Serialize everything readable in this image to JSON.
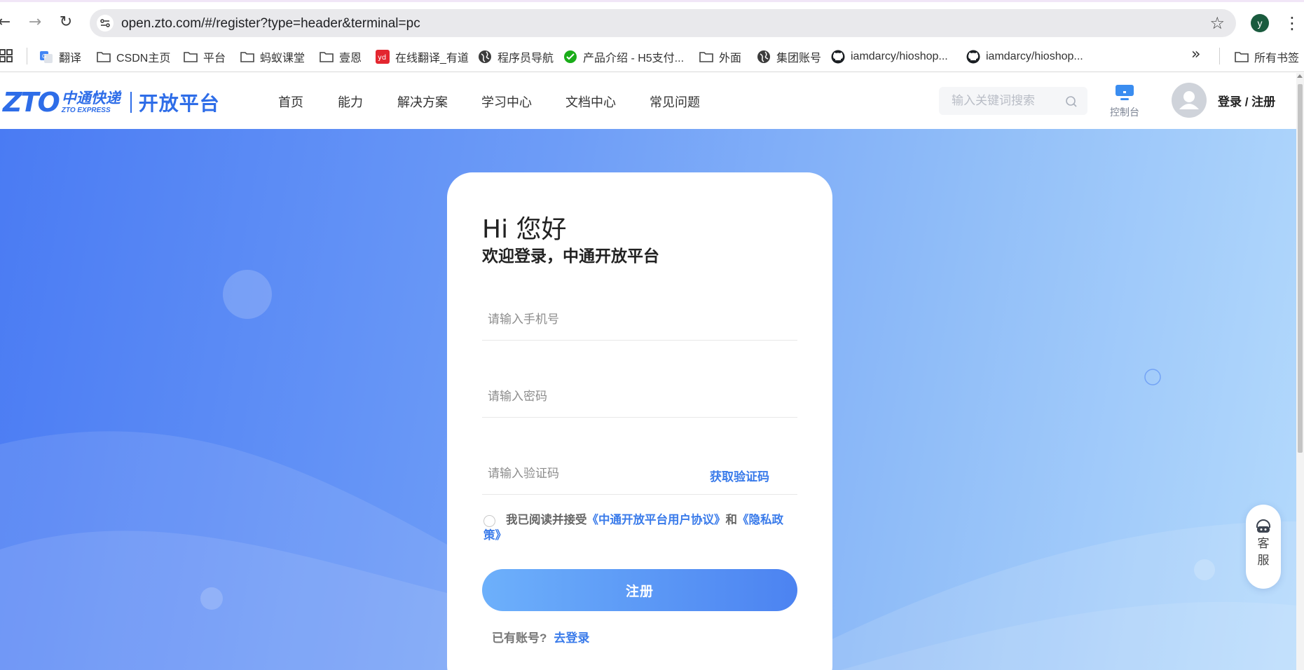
{
  "browser": {
    "url": "open.zto.com/#/register?type=header&terminal=pc",
    "profile_initial": "y",
    "bookmarks": [
      {
        "label": "翻译",
        "icon": "google-translate-icon"
      },
      {
        "label": "CSDN主页",
        "icon": "folder-icon"
      },
      {
        "label": "平台",
        "icon": "folder-icon"
      },
      {
        "label": "蚂蚁课堂",
        "icon": "folder-icon"
      },
      {
        "label": "壹恩",
        "icon": "folder-icon"
      },
      {
        "label": "在线翻译_有道",
        "icon": "youdao-icon"
      },
      {
        "label": "程序员导航",
        "icon": "globe-icon"
      },
      {
        "label": "产品介绍 - H5支付...",
        "icon": "wechat-icon"
      },
      {
        "label": "外面",
        "icon": "folder-icon"
      },
      {
        "label": "集团账号",
        "icon": "globe-icon"
      },
      {
        "label": "iamdarcy/hioshop...",
        "icon": "github-icon"
      },
      {
        "label": "iamdarcy/hioshop...",
        "icon": "github-icon"
      }
    ],
    "all_bookmarks_label": "所有书签"
  },
  "site": {
    "logo_text": "ZTO",
    "logo_cn": "中通快递",
    "logo_en": "ZTO EXPRESS",
    "platform_name": "开放平台",
    "nav": [
      "首页",
      "能力",
      "解决方案",
      "学习中心",
      "文档中心",
      "常见问题"
    ],
    "search_placeholder": "输入关键词搜索",
    "console_label": "控制台",
    "login_label": "登录 / 注册"
  },
  "form": {
    "greeting": "Hi 您好",
    "welcome": "欢迎登录，中通开放平台",
    "phone_placeholder": "请输入手机号",
    "password_placeholder": "请输入密码",
    "code_placeholder": "请输入验证码",
    "get_code_label": "获取验证码",
    "agree_prefix": "我已阅读并接受",
    "agree_link1": "《中通开放平台用户协议》",
    "agree_and": "和",
    "agree_link2": "《隐私政策》",
    "submit_label": "注册",
    "have_account": "已有账号?",
    "go_login": "去登录"
  },
  "customer_service": {
    "label": "客服"
  },
  "colors": {
    "brand": "#2e6de8",
    "link": "#3a7bea",
    "hero_start": "#4a7bf3",
    "hero_end": "#b4dafc"
  }
}
